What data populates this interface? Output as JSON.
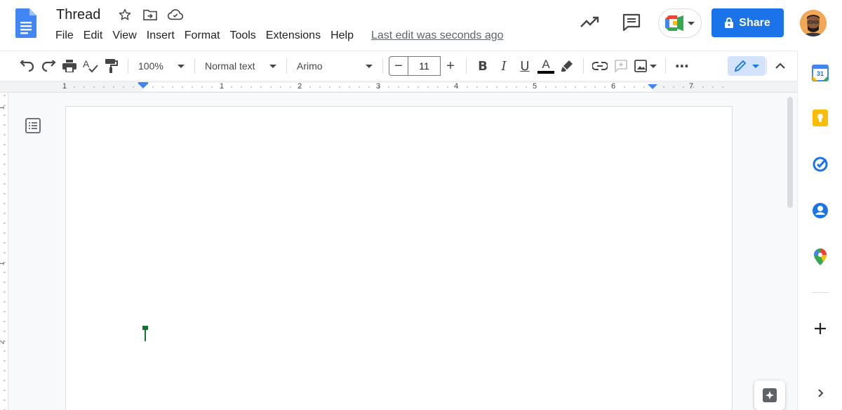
{
  "document": {
    "title": "Thread",
    "last_edit": "Last edit was seconds ago"
  },
  "menu": [
    "File",
    "Edit",
    "View",
    "Insert",
    "Format",
    "Tools",
    "Extensions",
    "Help"
  ],
  "header": {
    "share_label": "Share"
  },
  "toolbar": {
    "zoom": "100%",
    "style": "Normal text",
    "font": "Arimo",
    "font_size": "11",
    "minus": "−",
    "plus": "+",
    "bold": "B",
    "italic": "I",
    "underline": "U",
    "text_color_glyph": "A",
    "more": "⋯"
  },
  "ruler": {
    "labels": [
      "1",
      "1",
      "2",
      "3",
      "4",
      "5",
      "6",
      "7"
    ],
    "vlabels": [
      "1",
      "1",
      "2"
    ]
  },
  "side_panel": {
    "calendar_day": "31"
  },
  "colors": {
    "accent": "#1a73e8",
    "doc_blue": "#4285f4",
    "cursor": "#137333",
    "keep_yellow": "#fbbc04",
    "edit_mode_bg": "#d3e3fd"
  },
  "icons": [
    "docs-logo-icon",
    "star-icon",
    "move-folder-icon",
    "cloud-saved-icon",
    "trending-icon",
    "comments-icon",
    "meet-icon",
    "lock-icon",
    "undo-icon",
    "redo-icon",
    "print-icon",
    "spellcheck-icon",
    "paint-format-icon",
    "link-icon",
    "add-comment-icon",
    "image-icon",
    "pencil-icon",
    "chevron-up-icon",
    "outline-icon",
    "calendar-icon",
    "keep-icon",
    "tasks-icon",
    "contacts-icon",
    "maps-icon",
    "add-icon",
    "chevron-right-icon",
    "explore-icon"
  ]
}
